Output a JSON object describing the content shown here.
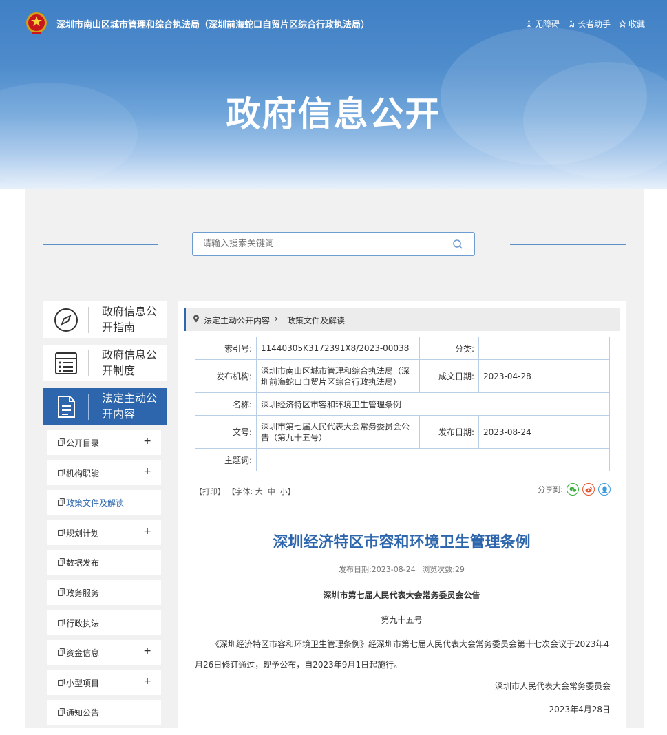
{
  "header": {
    "site_title": "深圳市南山区城市管理和综合执法局（深圳前海蛇口自贸片区综合行政执法局）",
    "links": [
      {
        "icon": "accessibility-icon",
        "label": "无障碍"
      },
      {
        "icon": "elder-helper-icon",
        "label": "长者助手"
      },
      {
        "icon": "star-icon",
        "label": "收藏"
      }
    ],
    "banner_title": "政府信息公开"
  },
  "search": {
    "placeholder": "请输入搜索关键词"
  },
  "sidebar": {
    "categories": [
      {
        "label": "政府信息公开指南",
        "icon": "compass-icon"
      },
      {
        "label": "政府信息公开制度",
        "icon": "list-document-icon"
      },
      {
        "label": "法定主动公开内容",
        "icon": "document-icon"
      }
    ],
    "items": [
      {
        "label": "公开目录",
        "expandable": "+"
      },
      {
        "label": "机构职能",
        "expandable": "+"
      },
      {
        "label": "政策文件及解读",
        "expandable": ""
      },
      {
        "label": "规划计划",
        "expandable": "+"
      },
      {
        "label": "数据发布",
        "expandable": ""
      },
      {
        "label": "政务服务",
        "expandable": ""
      },
      {
        "label": "行政执法",
        "expandable": ""
      },
      {
        "label": "资金信息",
        "expandable": "+"
      },
      {
        "label": "小型项目",
        "expandable": "+"
      },
      {
        "label": "通知公告",
        "expandable": ""
      }
    ]
  },
  "breadcrumb": {
    "parent": "法定主动公开内容",
    "separator": "›",
    "current": "政策文件及解读"
  },
  "meta": {
    "index_label": "索引号:",
    "index_value": "11440305K3172391X8/2023-00038",
    "category_label": "分类:",
    "category_value": "",
    "publisher_label": "发布机构:",
    "publisher_value": "深圳市南山区城市管理和综合执法局（深圳前海蛇口自贸片区综合行政执法局）",
    "created_label": "成文日期:",
    "created_value": "2023-04-28",
    "name_label": "名称:",
    "name_value": "深圳经济特区市容和环境卫生管理条例",
    "docno_label": "文号:",
    "docno_value": "深圳市第七届人民代表大会常务委员会公告（第九十五号）",
    "published_label": "发布日期:",
    "published_value": "2023-08-24",
    "subject_label": "主题词:",
    "subject_value": ""
  },
  "tools": {
    "print": "【打印】",
    "font_label": "【字体:",
    "large": "大",
    "medium": "中",
    "small": "小",
    "font_end": "】",
    "share_label": "分享到:"
  },
  "article": {
    "title": "深圳经济特区市容和环境卫生管理条例",
    "publish_label": "发布日期:",
    "publish_date": "2023-08-24",
    "views_label": "浏览次数:",
    "views": "29",
    "announcement": "深圳市第七届人民代表大会常务委员会公告",
    "number": "第九十五号",
    "body": "《深圳经济特区市容和环境卫生管理条例》经深圳市第七届人民代表大会常务委员会第十七次会议于2023年4月26日修订通过，现予公布，自2023年9月1日起施行。",
    "signer": "深圳市人民代表大会常务委员会",
    "sign_date": "2023年4月28日"
  },
  "colors": {
    "brand_blue": "#2d66ad",
    "banner_blue": "#4e8ccc",
    "panel_bg": "#f1f1f1",
    "wechat_green": "#3ab03e",
    "weibo_red": "#e6532e",
    "qq_blue": "#3a9be0"
  }
}
